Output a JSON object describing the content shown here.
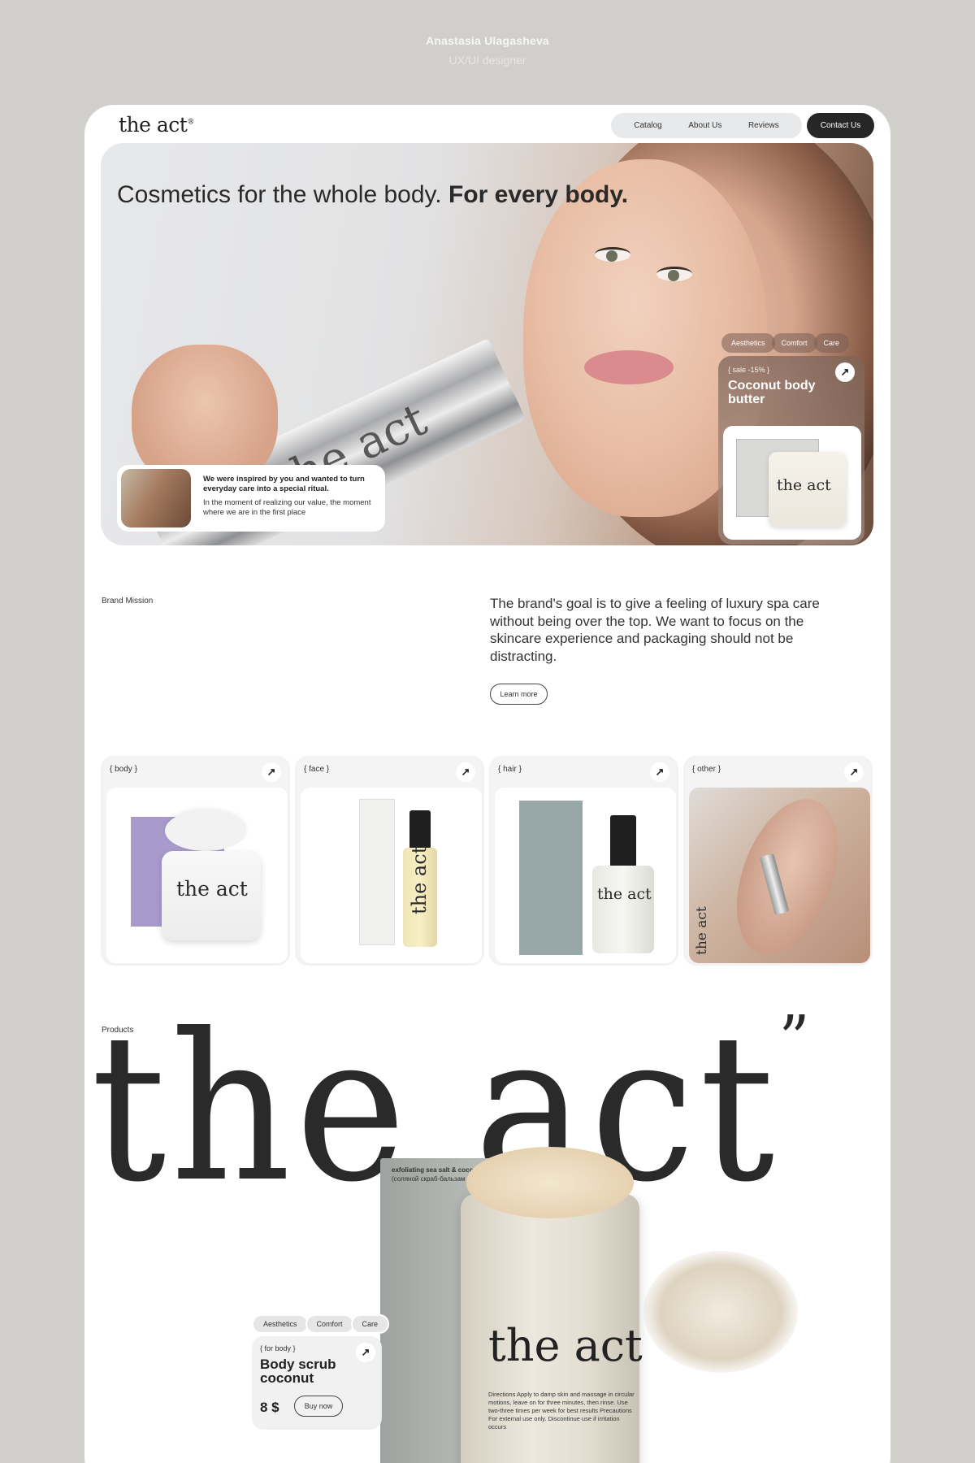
{
  "author": {
    "name": "Anastasia Ulagasheva",
    "role": "UX/UI designer"
  },
  "header": {
    "logo": "the act",
    "nav": [
      "Catalog",
      "About Us",
      "Reviews"
    ],
    "contact": "Contact Us"
  },
  "hero": {
    "title_regular": "Cosmetics for the whole body. ",
    "title_bold": "For every body.",
    "tube_logo": "the act",
    "inspire_title": "We were inspired by you and wanted to turn everyday care into a special ritual.",
    "inspire_text": "In the moment of realizing our value, the moment where we are in the first place",
    "tags": [
      "Aesthetics",
      "Comfort",
      "Care"
    ],
    "promo": {
      "sale": "{ sale -15% }",
      "title": "Coconut body butter",
      "jar_logo": "the act"
    }
  },
  "mission": {
    "label": "Brand Mission",
    "text": "The brand's goal is to give a feeling of luxury spa care without being over the top. We want to focus on the skincare experience and packaging should not be distracting.",
    "button": "Learn more"
  },
  "categories": [
    {
      "label": "{ body }",
      "logo": "the act"
    },
    {
      "label": "{ face }",
      "logo": "the act"
    },
    {
      "label": "{ hair }",
      "logo": "the act"
    },
    {
      "label": "{ other }",
      "logo": "the act"
    }
  ],
  "products": {
    "label": "Products",
    "big_logo": "the act",
    "box_title": "exfoliating sea salt & coco body b",
    "box_subtitle": "(соляной скраб-бальзам для т",
    "jar_logo": "the act",
    "directions": "Directions Apply to damp skin and massage in circular motions, leave on for three minutes, then rinse. Use two-three times per week for best results Precautions For external use only. Discontinue use if irritation occurs",
    "tags": [
      "Aesthetics",
      "Comfort",
      "Care"
    ],
    "card": {
      "category": "{ for body }",
      "name": "Body scrub coconut",
      "price": "8 $",
      "buy": "Buy now"
    }
  },
  "icons": {
    "arrow": "arrow-up-right-icon"
  }
}
